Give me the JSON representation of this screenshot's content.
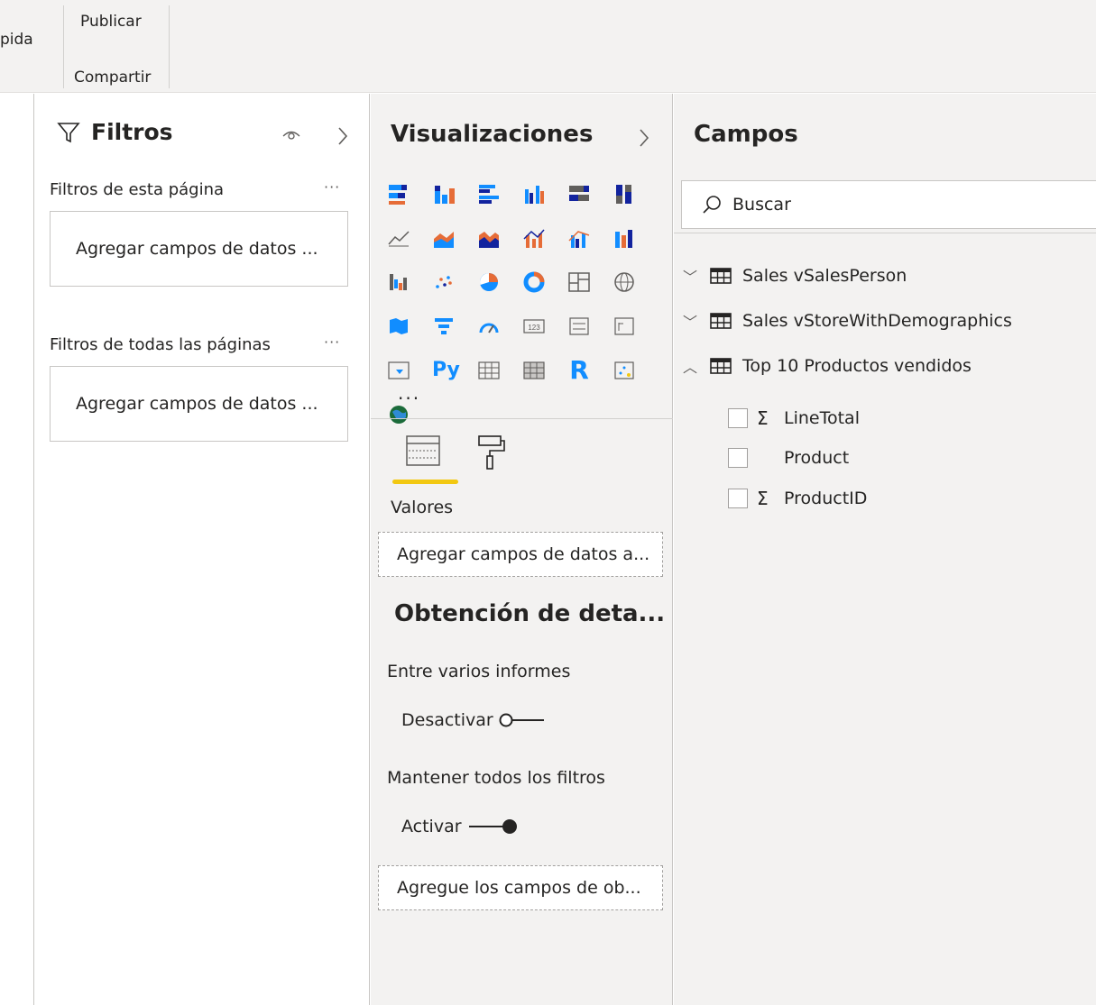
{
  "ribbon": {
    "cut_label": "pida",
    "publish_label": "Publicar",
    "share_group_label": "Compartir"
  },
  "filters": {
    "title": "Filtros",
    "page_section": "Filtros de esta página",
    "page_placeholder": "Agregar campos de datos ...",
    "all_section": "Filtros de todas las páginas",
    "all_placeholder": "Agregar campos de datos ...",
    "more": "···"
  },
  "visualizations": {
    "title": "Visualizaciones",
    "more_visuals": "···",
    "values_label": "Valores",
    "values_placeholder": "Agregar campos de datos a...",
    "drillthrough_heading": "Obtención de deta...",
    "cross_report_label": "Entre varios informes",
    "cross_report_state": "Desactivar",
    "keep_filters_label": "Mantener todos los filtros",
    "keep_filters_state": "Activar",
    "drillthrough_placeholder": "Agregue los campos de ob...",
    "icons": [
      "stacked-bar-icon",
      "stacked-column-icon",
      "clustered-bar-icon",
      "clustered-column-icon",
      "100-bar-icon",
      "100-column-icon",
      "line-chart-icon",
      "area-chart-icon",
      "stacked-area-icon",
      "line-column-icon",
      "line-clustered-column-icon",
      "ribbon-chart-icon",
      "waterfall-icon",
      "scatter-icon",
      "pie-chart-icon",
      "donut-chart-icon",
      "treemap-icon",
      "map-icon",
      "filled-map-icon",
      "funnel-icon",
      "gauge-icon",
      "card-icon",
      "multi-row-card-icon",
      "kpi-icon",
      "slicer-icon",
      "python-visual-icon",
      "table-icon",
      "matrix-icon",
      "r-visual-icon",
      "key-influencers-icon",
      "arcgis-map-icon"
    ],
    "python_glyph": "Py",
    "r_glyph": "R",
    "card_glyph": "123"
  },
  "fields": {
    "title": "Campos",
    "search_placeholder": "Buscar",
    "tables": [
      {
        "name": "Sales vSalesPerson",
        "expanded": false
      },
      {
        "name": "Sales vStoreWithDemographics",
        "expanded": false
      },
      {
        "name": "Top 10 Productos vendidos",
        "expanded": true
      }
    ],
    "columns": [
      {
        "name": "LineTotal",
        "sigma": "Σ"
      },
      {
        "name": "Product",
        "sigma": ""
      },
      {
        "name": "ProductID",
        "sigma": "Σ"
      }
    ]
  },
  "colors": {
    "accent": "#f2c811",
    "chart_blue": "#118dff",
    "chart_navy": "#12239e",
    "chart_orange": "#e66c37"
  }
}
